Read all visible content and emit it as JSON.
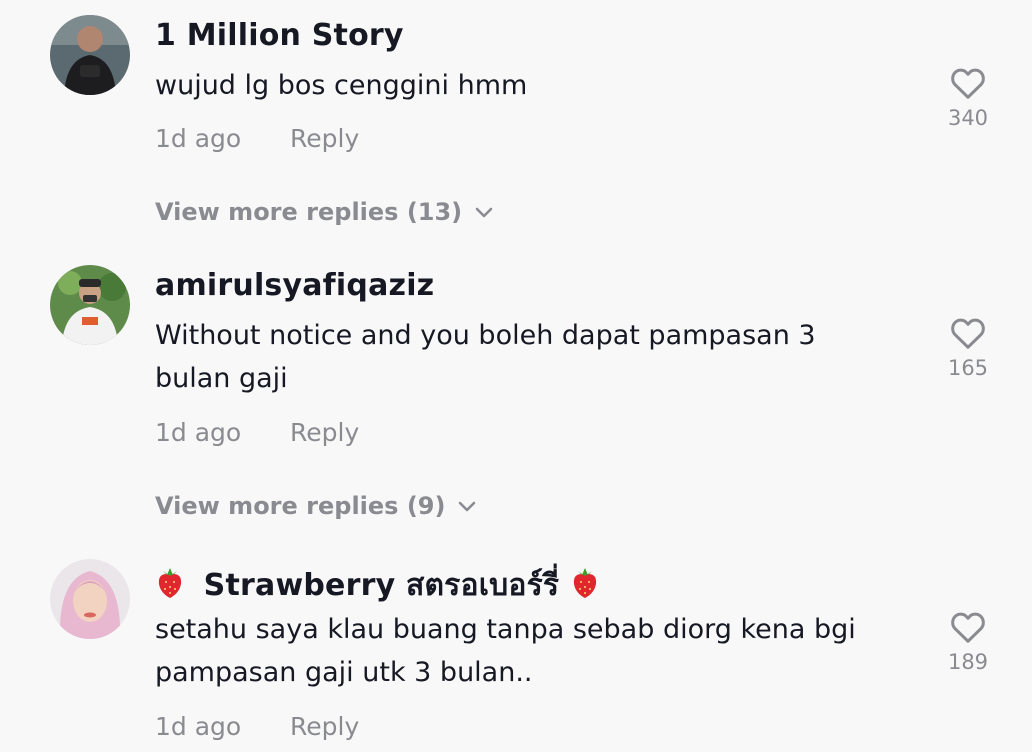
{
  "comments": [
    {
      "username": "1 Million Story",
      "text": "wujud lg bos cenggini hmm",
      "time": "1d ago",
      "reply": "Reply",
      "likes": "340",
      "more_replies": "View more replies (13)"
    },
    {
      "username": "amirulsyafiqaziz",
      "text": "Without notice and you boleh dapat pampasan 3 bulan gaji",
      "time": "1d ago",
      "reply": "Reply",
      "likes": "165",
      "more_replies": "View more replies (9)"
    },
    {
      "username": "Strawberry สตรอเบอร์รี่",
      "text": "setahu saya klau buang tanpa sebab diorg kena bgi pampasan gaji utk 3 bulan..",
      "time": "1d ago",
      "reply": "Reply",
      "likes": "189"
    }
  ],
  "icons": {
    "like": "heart-outline-icon",
    "expand": "chevron-down-icon",
    "emoji": "strawberry-icon"
  },
  "colors": {
    "background": "#f8f8f8",
    "primary_text": "#161823",
    "secondary_text": "#8a8b91"
  }
}
